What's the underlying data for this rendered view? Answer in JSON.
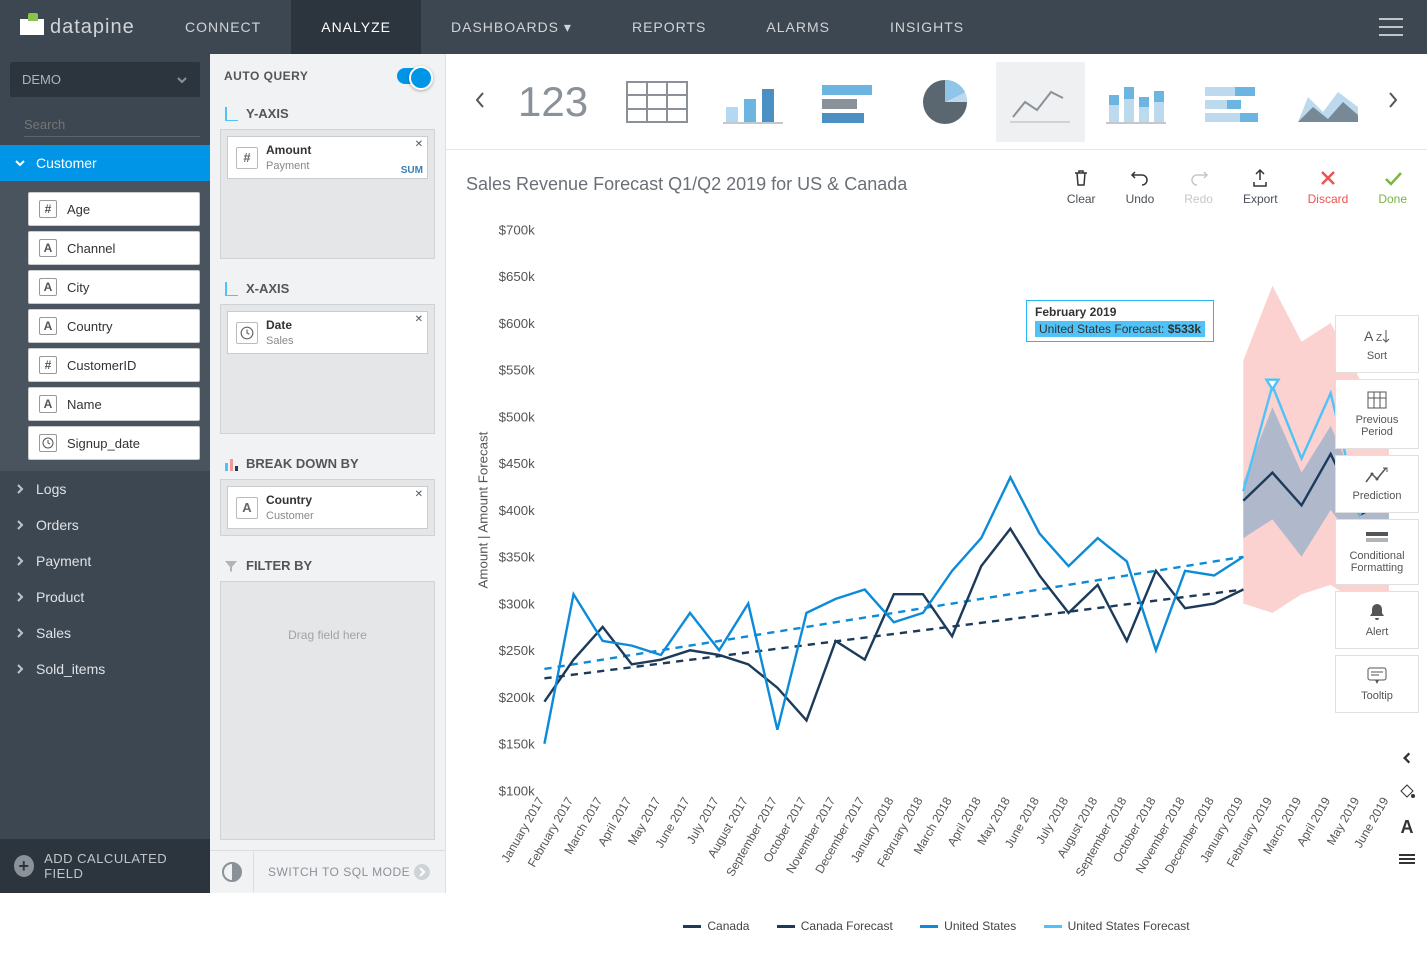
{
  "brand": "datapine",
  "nav": [
    "CONNECT",
    "ANALYZE",
    "DASHBOARDS",
    "REPORTS",
    "ALARMS",
    "INSIGHTS"
  ],
  "nav_active_index": 1,
  "source": {
    "label": "DEMO"
  },
  "search": {
    "placeholder": "Search"
  },
  "sidebar": {
    "active_section": "Customer",
    "customer_fields": [
      {
        "type": "#",
        "label": "Age"
      },
      {
        "type": "A",
        "label": "Channel"
      },
      {
        "type": "A",
        "label": "City"
      },
      {
        "type": "A",
        "label": "Country"
      },
      {
        "type": "#",
        "label": "CustomerID"
      },
      {
        "type": "A",
        "label": "Name"
      },
      {
        "type": "clock",
        "label": "Signup_date"
      }
    ],
    "sections": [
      "Logs",
      "Orders",
      "Payment",
      "Product",
      "Sales",
      "Sold_items"
    ],
    "add_calc": "ADD CALCULATED FIELD"
  },
  "config": {
    "auto_query": "AUTO QUERY",
    "yaxis_label": "Y-AXIS",
    "yaxis_pill": {
      "name": "Amount",
      "sub": "Payment",
      "agg": "SUM"
    },
    "xaxis_label": "X-AXIS",
    "xaxis_pill": {
      "name": "Date",
      "sub": "Sales"
    },
    "breakdown_label": "BREAK DOWN BY",
    "breakdown_pill": {
      "name": "Country",
      "sub": "Customer"
    },
    "filter_label": "FILTER BY",
    "filter_hint": "Drag field here",
    "sql_switch": "SWITCH TO SQL MODE"
  },
  "chart_types": {
    "number": "123",
    "active_index": 4
  },
  "chart_header": {
    "title": "Sales Revenue Forecast Q1/Q2 2019 for US & Canada",
    "actions": [
      {
        "key": "clear",
        "label": "Clear"
      },
      {
        "key": "undo",
        "label": "Undo"
      },
      {
        "key": "redo",
        "label": "Redo",
        "disabled": true
      },
      {
        "key": "export",
        "label": "Export"
      },
      {
        "key": "discard",
        "label": "Discard"
      },
      {
        "key": "done",
        "label": "Done"
      }
    ]
  },
  "right_tools": [
    {
      "key": "sort",
      "label": "Sort"
    },
    {
      "key": "prev",
      "label": "Previous Period"
    },
    {
      "key": "prediction",
      "label": "Prediction"
    },
    {
      "key": "condfmt",
      "label": "Conditional Formatting"
    },
    {
      "key": "alert",
      "label": "Alert"
    },
    {
      "key": "tooltip",
      "label": "Tooltip"
    }
  ],
  "tooltip": {
    "month": "February 2019",
    "series_label": "United States Forecast:",
    "value": "$533k"
  },
  "chart_data": {
    "type": "line",
    "title": "Sales Revenue Forecast Q1/Q2 2019 for US & Canada",
    "xlabel": "",
    "ylabel": "Amount | Amount Forecast",
    "ylim": [
      100000,
      700000
    ],
    "y_ticks": [
      "$100k",
      "$150k",
      "$200k",
      "$250k",
      "$300k",
      "$350k",
      "$400k",
      "$450k",
      "$500k",
      "$550k",
      "$600k",
      "$650k",
      "$700k"
    ],
    "categories": [
      "January 2017",
      "February 2017",
      "March 2017",
      "April 2017",
      "May 2017",
      "June 2017",
      "July 2017",
      "August 2017",
      "September 2017",
      "October 2017",
      "November 2017",
      "December 2017",
      "January 2018",
      "February 2018",
      "March 2018",
      "April 2018",
      "May 2018",
      "June 2018",
      "July 2018",
      "August 2018",
      "September 2018",
      "October 2018",
      "November 2018",
      "December 2018",
      "January 2019",
      "February 2019",
      "March 2019",
      "April 2019",
      "May 2019",
      "June 2019"
    ],
    "history_len": 24,
    "series": [
      {
        "name": "Canada",
        "color": "#1c3b5a",
        "values": [
          195,
          240,
          275,
          235,
          240,
          250,
          245,
          235,
          210,
          175,
          260,
          240,
          310,
          310,
          265,
          340,
          380,
          330,
          290,
          320,
          260,
          335,
          295,
          300,
          315,
          null,
          null,
          null,
          null,
          null
        ]
      },
      {
        "name": "Canada Forecast",
        "color": "#1c3b5a",
        "dashed": false,
        "forecast": true,
        "values": [
          null,
          null,
          null,
          null,
          null,
          null,
          null,
          null,
          null,
          null,
          null,
          null,
          null,
          null,
          null,
          null,
          null,
          null,
          null,
          null,
          null,
          null,
          null,
          null,
          410,
          440,
          405,
          460,
          395,
          410
        ]
      },
      {
        "name": "United States",
        "color": "#0d8bd9",
        "values": [
          150,
          310,
          260,
          255,
          245,
          290,
          250,
          300,
          165,
          290,
          305,
          315,
          280,
          290,
          335,
          370,
          435,
          375,
          340,
          370,
          345,
          250,
          335,
          330,
          350,
          null,
          null,
          null,
          null,
          null
        ]
      },
      {
        "name": "United States Forecast",
        "color": "#4fc3f7",
        "dashed": false,
        "forecast": true,
        "values": [
          null,
          null,
          null,
          null,
          null,
          null,
          null,
          null,
          null,
          null,
          null,
          null,
          null,
          null,
          null,
          null,
          null,
          null,
          null,
          null,
          null,
          null,
          null,
          null,
          420,
          533,
          455,
          525,
          395,
          450
        ]
      }
    ],
    "trend_lines": [
      {
        "name": "Canada trend",
        "color": "#1c3b5a",
        "dashed": true,
        "start": 220,
        "end": 315
      },
      {
        "name": "US trend",
        "color": "#0d8bd9",
        "dashed": true,
        "start": 230,
        "end": 350
      }
    ],
    "forecast_bands": [
      {
        "name": "US band",
        "color": "#f8b4b0",
        "lower": [
          300,
          290,
          310,
          320,
          300,
          305
        ],
        "upper": [
          560,
          640,
          580,
          600,
          540,
          530
        ]
      },
      {
        "name": "Canada band",
        "color": "#7ea6c9",
        "lower": [
          370,
          390,
          350,
          400,
          360,
          360
        ],
        "upper": [
          430,
          510,
          440,
          490,
          420,
          420
        ]
      }
    ],
    "legend": [
      "Canada",
      "Canada Forecast",
      "United States",
      "United States Forecast"
    ]
  }
}
